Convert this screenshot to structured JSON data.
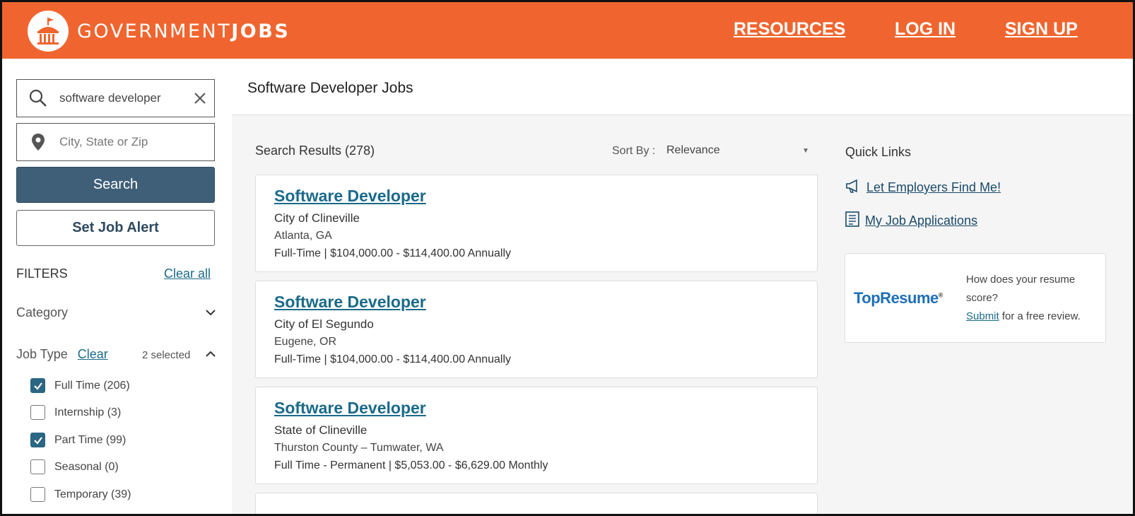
{
  "header": {
    "brand_light": "GOVERNMENT",
    "brand_bold": "JOBS",
    "nav": [
      "RESOURCES",
      "LOG IN",
      "SIGN UP"
    ]
  },
  "page": {
    "title": "Software Developer Jobs"
  },
  "search": {
    "keyword_value": "software developer",
    "location_placeholder": "City, State or Zip",
    "search_label": "Search",
    "alert_label": "Set Job Alert"
  },
  "filters": {
    "label": "FILTERS",
    "clear_all": "Clear all",
    "category": "Category",
    "job_type": "Job Type",
    "job_type_clear": "Clear",
    "job_type_selected": "2 selected",
    "options": [
      {
        "label": "Full Time (206)",
        "checked": true
      },
      {
        "label": "Internship (3)",
        "checked": false
      },
      {
        "label": "Part Time (99)",
        "checked": true
      },
      {
        "label": "Seasonal (0)",
        "checked": false
      },
      {
        "label": "Temporary (39)",
        "checked": false
      }
    ]
  },
  "results": {
    "count_label": "Search Results (278)",
    "sort_label": "Sort By :",
    "sort_value": "Relevance",
    "jobs": [
      {
        "title": "Software Developer",
        "employer": "City of Clineville",
        "location": "Atlanta, GA",
        "salary": "Full-Time | $104,000.00 - $114,400.00 Annually"
      },
      {
        "title": "Software Developer",
        "employer": "City of El Segundo",
        "location": "Eugene, OR",
        "salary": "Full-Time | $104,000.00 - $114,400.00 Annually"
      },
      {
        "title": "Software Developer",
        "employer": "State of Clineville",
        "location": "Thurston County – Tumwater, WA",
        "salary": "Full Time - Permanent | $5,053.00 - $6,629.00 Monthly"
      }
    ]
  },
  "quick_links": {
    "title": "Quick Links",
    "links": [
      " Let Employers Find Me!",
      " My Job Applications"
    ]
  },
  "resume_ad": {
    "brand": "TopResume",
    "question": "How does your resume score?",
    "submit": "Submit",
    "tail": " for a free review."
  },
  "colors": {
    "header": "#f0652f",
    "primary_button": "#3f5f79",
    "link": "#1a6a8a"
  },
  "icons": [
    "capitol-logo-icon",
    "search-icon",
    "close-icon",
    "map-pin-icon",
    "chevron-down-icon",
    "chevron-up-icon",
    "check-icon",
    "megaphone-icon",
    "document-list-icon"
  ]
}
